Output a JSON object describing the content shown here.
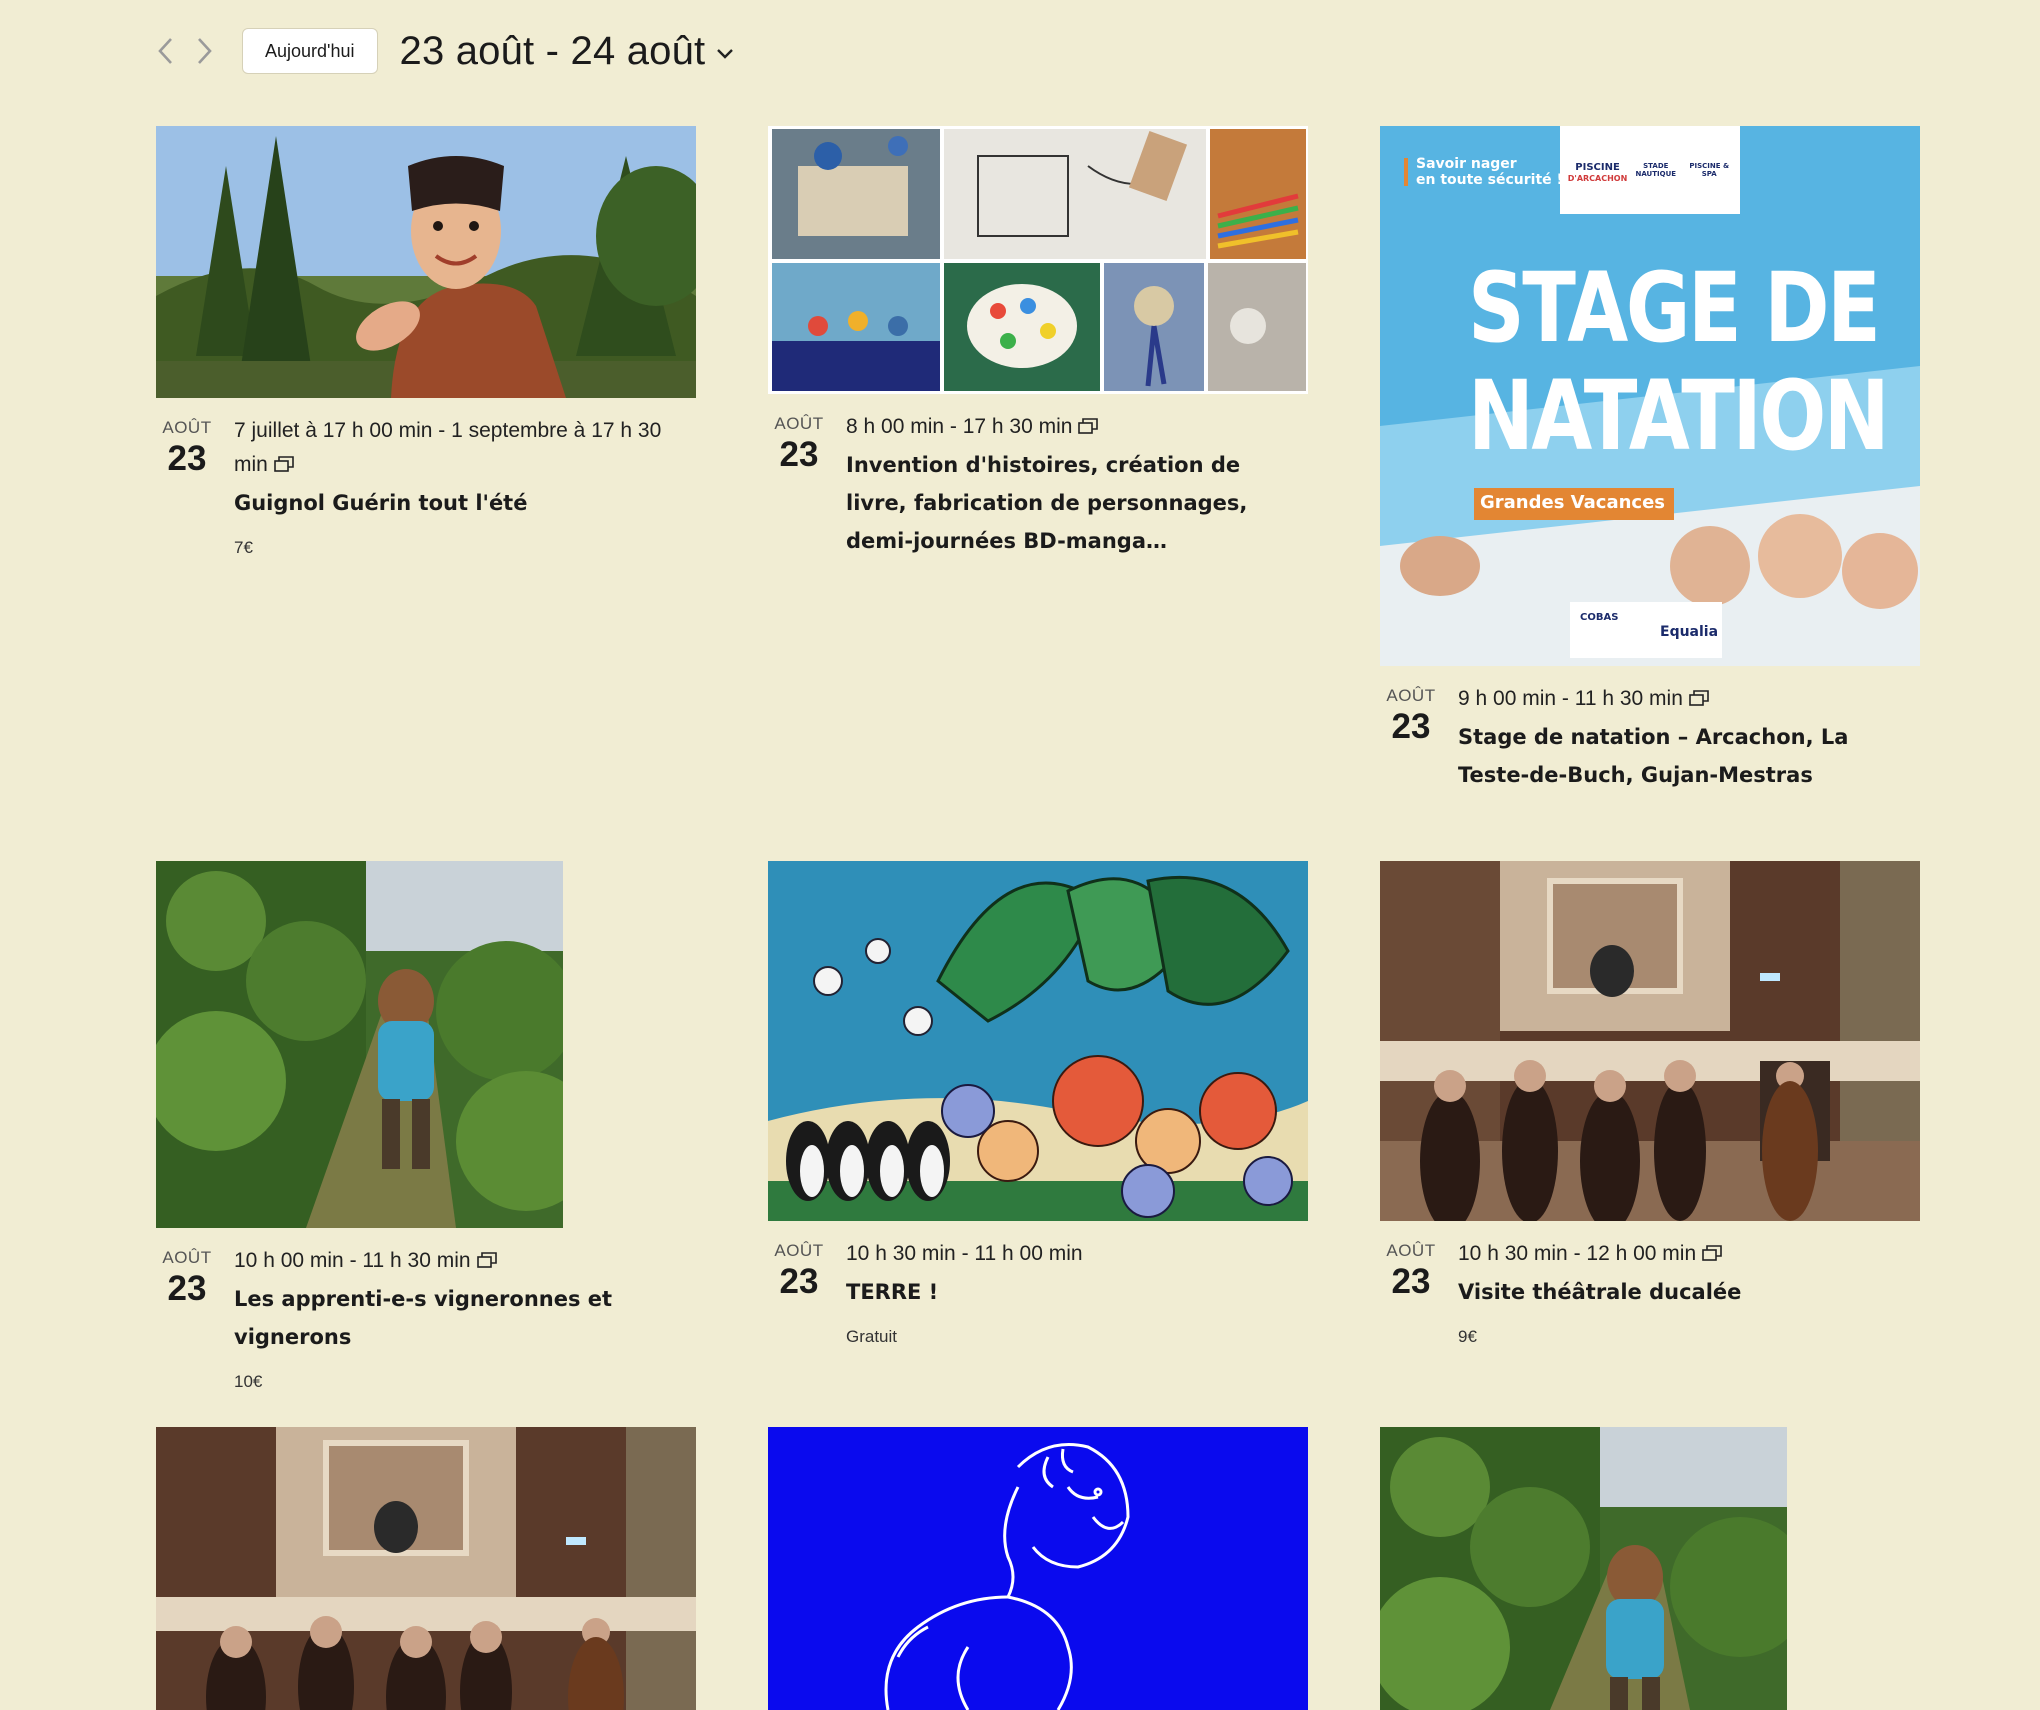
{
  "toolbar": {
    "today_label": "Aujourd'hui",
    "range_label": "23 août - 24 août"
  },
  "events": [
    {
      "month": "AOÛT",
      "day": "23",
      "time": "7 juillet à 17 h 00 min - 1 septembre à 17 h 30 min",
      "title": "Guignol Guérin tout l'été",
      "price": "7€",
      "image_text": []
    },
    {
      "month": "AOÛT",
      "day": "23",
      "time": "8 h 00 min - 17 h 30 min",
      "title": "Invention d'histoires, création de livre, fabrication de personnages, demi-journées BD-manga…",
      "price": "",
      "image_text": []
    },
    {
      "month": "AOÛT",
      "day": "23",
      "time": "9 h 00 min - 11 h 30 min",
      "title": "Stage de natation – Arcachon, La Teste-de-Buch, Gujan-Mestras",
      "price": "",
      "poster": {
        "tagline_1": "Savoir nager",
        "tagline_2": "en toute sécurité !",
        "headline_1": "STAGE DE",
        "headline_2": "NATATION",
        "badge": "Grandes Vacances",
        "partner": "Equalia",
        "logo_1": "PISCINE",
        "logo_1b": "D'ARCACHON",
        "logo_2": "STADE NAUTIQUE",
        "logo_3": "PISCINE & SPA",
        "cobas": "COBAS"
      }
    },
    {
      "month": "AOÛT",
      "day": "23",
      "time": "10 h 00 min - 11 h 30 min",
      "title": "Les apprenti-e-s vigneronnes et vignerons",
      "price": "10€"
    },
    {
      "month": "AOÛT",
      "day": "23",
      "time": "10 h 30 min - 11 h 00 min",
      "title": "TERRE !",
      "price": "Gratuit"
    },
    {
      "month": "AOÛT",
      "day": "23",
      "time": "10 h 30 min - 12 h 00 min",
      "title": "Visite théâtrale ducalée",
      "price": "9€"
    }
  ],
  "colors": {
    "background": "#f1edd3",
    "pool_blue": "#57b4e2",
    "badge_orange": "#e38633",
    "lion_blue": "#0a0aee"
  },
  "icons": [
    "chevron-left-icon",
    "chevron-right-icon",
    "chevron-down-icon",
    "recurring-icon"
  ]
}
